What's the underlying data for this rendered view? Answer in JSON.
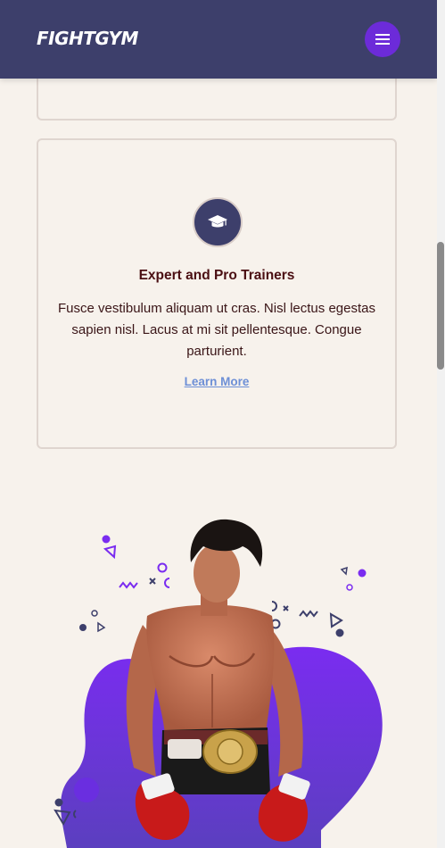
{
  "header": {
    "logo": "FIGHTGYM",
    "menu_icon": "hamburger-icon",
    "background": "#3d3f6b",
    "menu_color": "#6c2bd9"
  },
  "feature_card": {
    "icon": "graduation-cap-icon",
    "title": "Expert and Pro Trainers",
    "text": "Fusce vestibulum aliquam ut cras. Nisl lectus egestas sapien nisl. Lacus at mi sit pellentesque. Congue parturient.",
    "link": "Learn More"
  },
  "hero": {
    "image": "boxer-with-championship-belt",
    "blob_color": "#6c2bd9"
  },
  "colors": {
    "page_bg": "#f7f2ec",
    "title": "#4a0e12",
    "link": "#6d8fd6"
  }
}
